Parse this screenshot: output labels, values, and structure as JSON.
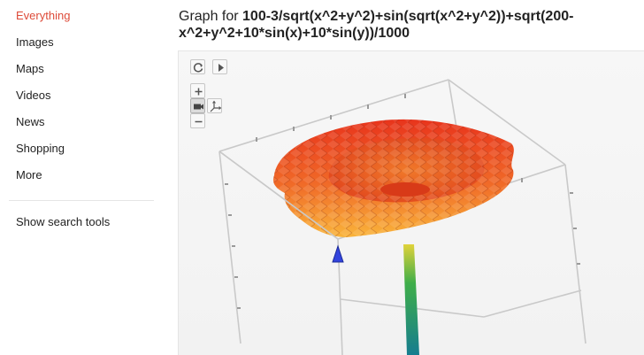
{
  "sidebar": {
    "items": [
      {
        "label": "Everything",
        "active": true
      },
      {
        "label": "Images"
      },
      {
        "label": "Maps"
      },
      {
        "label": "Videos"
      },
      {
        "label": "News"
      },
      {
        "label": "Shopping"
      },
      {
        "label": "More"
      }
    ],
    "search_tools": "Show search tools"
  },
  "graph": {
    "prefix": "Graph for ",
    "formula": "100-3/sqrt(x^2+y^2)+sin(sqrt(x^2+y^2))+sqrt(200-x^2+y^2+10*sin(x)+10*sin(y))/1000"
  },
  "colors": {
    "active_nav": "#dd4b39",
    "surface_top": "#e8341c",
    "surface_mid": "#f06a28",
    "surface_low": "#f9b43a",
    "stem_top": "#e0d23a",
    "stem_mid": "#3fae49",
    "stem_bottom": "#167d8f",
    "cursor": "#3344dd"
  },
  "controls": [
    {
      "name": "reset-view-icon"
    },
    {
      "name": "play-icon"
    },
    {
      "name": "zoom-in-icon"
    },
    {
      "name": "camera-icon"
    },
    {
      "name": "axes-icon"
    },
    {
      "name": "zoom-out-icon"
    }
  ]
}
